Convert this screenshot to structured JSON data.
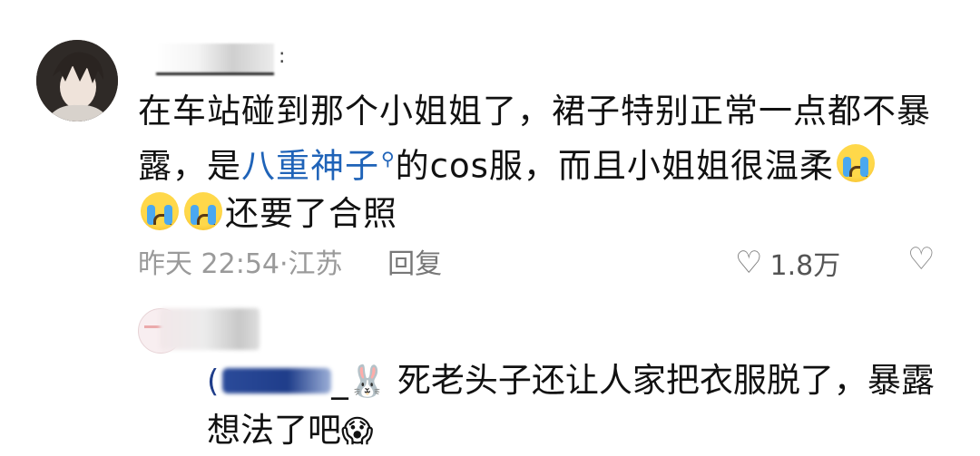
{
  "comment": {
    "name_tail": ":",
    "text_before_link": "在车站碰到那个小姐姐了，裙子特别正常一点都不暴露，是",
    "link_text": "八重神子",
    "link_icon": "search-icon",
    "text_after_link": "的cos服，而且小姐姐很温柔",
    "text_end": "还要了合照",
    "time": "昨天 22:54",
    "location_sep": "·",
    "location": "江苏",
    "reply_label": "回复",
    "likes": "1.8万",
    "colors": {
      "link": "#1f63b8",
      "meta": "#9a9a9a"
    }
  },
  "reply": {
    "mention_open": "(",
    "mention_sep": "_",
    "text_line1": "死老头子还让人家把衣服脱了，暴露",
    "text_line2": "想法了吧"
  }
}
